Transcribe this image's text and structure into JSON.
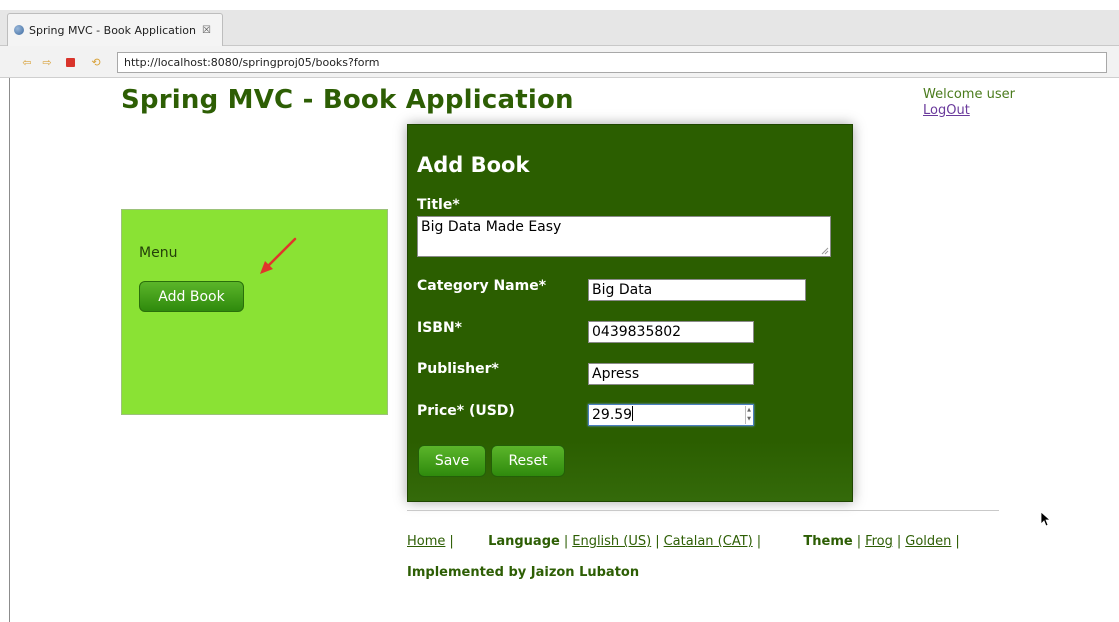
{
  "browser": {
    "tab_title": "Spring MVC - Book Application",
    "tab_close": "☒",
    "url": "http://localhost:8080/springproj05/books?form",
    "icons": [
      "back-icon",
      "forward-icon",
      "stop-icon",
      "refresh-icon",
      "globe-icon"
    ]
  },
  "header": {
    "title": "Spring MVC - Book Application",
    "welcome": "Welcome user",
    "logout": "LogOut"
  },
  "menu": {
    "label": "Menu",
    "add_book": "Add Book"
  },
  "form": {
    "heading": "Add Book",
    "fields": {
      "title": {
        "label": "Title*",
        "value": "Big Data Made Easy"
      },
      "category": {
        "label": "Category Name*",
        "value": "Big Data"
      },
      "isbn": {
        "label": "ISBN*",
        "value": "0439835802"
      },
      "publisher": {
        "label": "Publisher*",
        "value": "Apress"
      },
      "price": {
        "label": "Price* (USD)",
        "value": "29.59"
      }
    },
    "save": "Save",
    "reset": "Reset"
  },
  "footer": {
    "home": "Home",
    "language_label": "Language",
    "english": "English (US)",
    "catalan": "Catalan (CAT)",
    "theme_label": "Theme",
    "frog": "Frog",
    "golden": "Golden",
    "separator": "|",
    "credit": "Implemented by Jaizon Lubaton"
  },
  "colors": {
    "brand_green": "#2d5e04",
    "menu_bg": "#8ae234",
    "form_bg": "#2b5e00",
    "button_green": "#3f9a17",
    "annotation_arrow": "#e0352b"
  }
}
